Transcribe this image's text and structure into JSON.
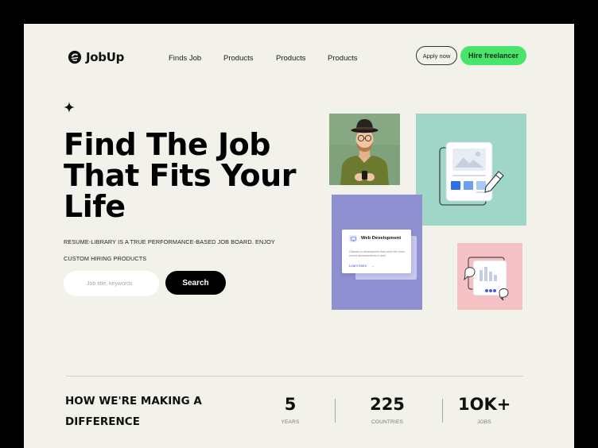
{
  "brand": {
    "name": "JobUp"
  },
  "nav": {
    "items": [
      {
        "label": "Finds Job"
      },
      {
        "label": "Products"
      },
      {
        "label": "Products"
      },
      {
        "label": "Products"
      }
    ]
  },
  "header_actions": {
    "apply_label": "Apply now",
    "hire_label": "Hire freelancer"
  },
  "hero": {
    "title_lines": [
      "Find The Job",
      "That Fits Your",
      "Life"
    ],
    "subtitle_lines": [
      "RESUME-LIBRARY IS A TRUE PERFORMANCE-BASED JOB BOARD. ENJOY",
      "CUSTOM HIRING PRODUCTS"
    ]
  },
  "search": {
    "placeholder": "Job title, keywords",
    "button_label": "Search"
  },
  "feature_card": {
    "title": "Web Development",
    "description": "Classes in development that cover the most recent advancements in web.",
    "link_label": "Learn More",
    "link_arrow": "→"
  },
  "difference": {
    "title_lines": [
      "HOW WE'RE MAKING A",
      "DIFFERENCE"
    ]
  },
  "stats": [
    {
      "value": "5",
      "label": "YEARS"
    },
    {
      "value": "225",
      "label": "COUNTRIES"
    },
    {
      "value": "1OK+",
      "label": "JOBS"
    }
  ],
  "colors": {
    "page_background": "#f3f2ea",
    "accent_green": "#49e46b",
    "tile_teal": "#9fd6c7",
    "tile_purple": "#8f90d1",
    "tile_pink": "#f6c1c5",
    "doc_blue": "#2f6fe8"
  },
  "icons": [
    "logo-mark-icon",
    "sparkle-icon",
    "document-image-icon",
    "pencil-icon",
    "chat-bubble-icon",
    "monitor-icon",
    "arrow-right-icon"
  ]
}
